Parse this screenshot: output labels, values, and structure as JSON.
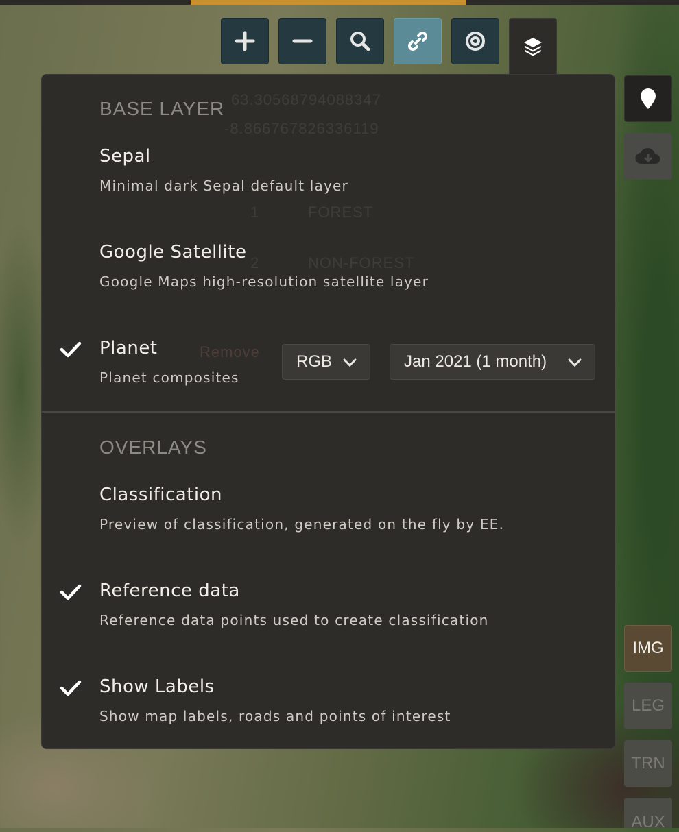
{
  "toolbar": {
    "zoom_in": "zoom-in",
    "zoom_out": "zoom-out",
    "search": "search",
    "link": "link",
    "target": "target",
    "layers": "layers"
  },
  "ghost_underlay": {
    "coord_1": "63.30568794088347",
    "coord_2": "-8.866767826336119",
    "class_1_number": "1",
    "class_1_label": "FOREST",
    "class_2_number": "2",
    "class_2_label": "NON-FOREST",
    "remove_label": "Remove"
  },
  "layers_panel": {
    "base_layer_title": "BASE LAYER",
    "base_layers": [
      {
        "title": "Sepal",
        "description": "Minimal dark Sepal default layer",
        "selected": false
      },
      {
        "title": "Google Satellite",
        "description": "Google Maps high-resolution satellite layer",
        "selected": false
      },
      {
        "title": "Planet",
        "description": "Planet composites",
        "selected": true
      }
    ],
    "planet_band_select": "RGB",
    "planet_date_select": "Jan 2021 (1 month)",
    "overlays_title": "OVERLAYS",
    "overlays": [
      {
        "title": "Classification",
        "description": "Preview of classification, generated on the fly by EE.",
        "selected": false
      },
      {
        "title": "Reference data",
        "description": "Reference data points used to create classification",
        "selected": true
      },
      {
        "title": "Show Labels",
        "description": "Show map labels, roads and points of interest",
        "selected": true
      }
    ]
  },
  "side_buttons": {
    "img": "IMG",
    "leg": "LEG",
    "trn": "TRN",
    "aux": "AUX"
  },
  "colors": {
    "accent_progress": "#c8902f",
    "active_tool": "#5b8b96",
    "panel_bg": "#2d2c29",
    "img_button_bg": "#5a4a33"
  }
}
